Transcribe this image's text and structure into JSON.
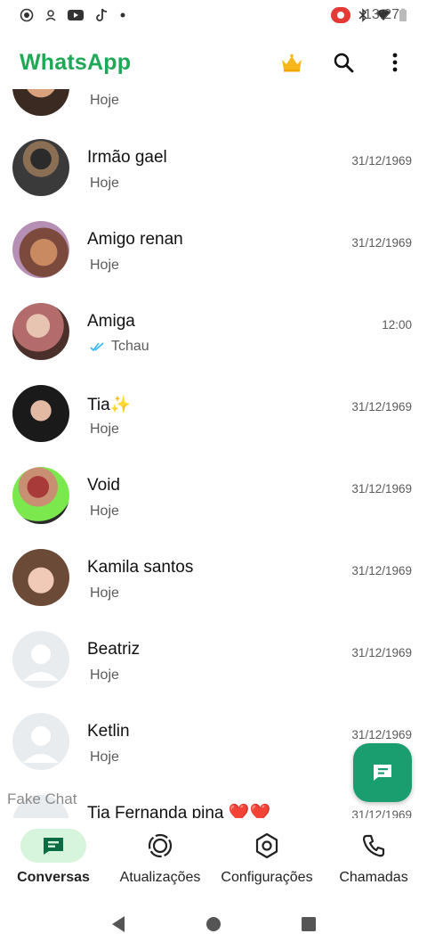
{
  "status_bar": {
    "time": "13:27",
    "left_icons": [
      "record-icon",
      "sync-icon",
      "youtube-icon",
      "tiktok-icon",
      "dot-icon"
    ],
    "right_icons": [
      "screen-record-icon",
      "bluetooth-icon",
      "wifi-icon",
      "battery-icon"
    ]
  },
  "app_bar": {
    "title": "WhatsApp",
    "title_color": "#1fa855",
    "actions": [
      "crown-icon",
      "search-icon",
      "more-vert-icon"
    ]
  },
  "chats": [
    {
      "name": "",
      "preview": "Hoje",
      "time": "",
      "avatar": "photo"
    },
    {
      "name": "Irmão gael",
      "preview": "Hoje",
      "time": "31/12/1969",
      "avatar": "photo"
    },
    {
      "name": "Amigo renan",
      "preview": "Hoje",
      "time": "31/12/1969",
      "avatar": "photo"
    },
    {
      "name": "Amiga",
      "preview": "Tchau",
      "time": "12:00",
      "avatar": "photo",
      "read_ticks": true
    },
    {
      "name": "Tia✨",
      "preview": "Hoje",
      "time": "31/12/1969",
      "avatar": "photo"
    },
    {
      "name": "Void",
      "preview": "Hoje",
      "time": "31/12/1969",
      "avatar": "photo"
    },
    {
      "name": "Kamila santos",
      "preview": "Hoje",
      "time": "31/12/1969",
      "avatar": "photo"
    },
    {
      "name": "Beatriz",
      "preview": "Hoje",
      "time": "31/12/1969",
      "avatar": "default"
    },
    {
      "name": "Ketlin",
      "preview": "Hoje",
      "time": "31/12/1969",
      "avatar": "default"
    },
    {
      "name": "Tia Fernanda pina ❤️❤️",
      "preview": "",
      "time": "31/12/1969",
      "avatar": "default"
    }
  ],
  "watermark": "Fake Chat",
  "fab": {
    "icon": "new-chat-icon",
    "color": "#1a9d6f"
  },
  "bottom_nav": {
    "items": [
      {
        "label": "Conversas",
        "icon": "chats-icon",
        "active": true
      },
      {
        "label": "Atualizações",
        "icon": "status-icon",
        "active": false
      },
      {
        "label": "Configurações",
        "icon": "settings-icon",
        "active": false
      },
      {
        "label": "Chamadas",
        "icon": "phone-icon",
        "active": false
      }
    ],
    "active_color": "#d7f5dc"
  },
  "system_nav": [
    "back-icon",
    "home-icon",
    "recents-icon"
  ]
}
